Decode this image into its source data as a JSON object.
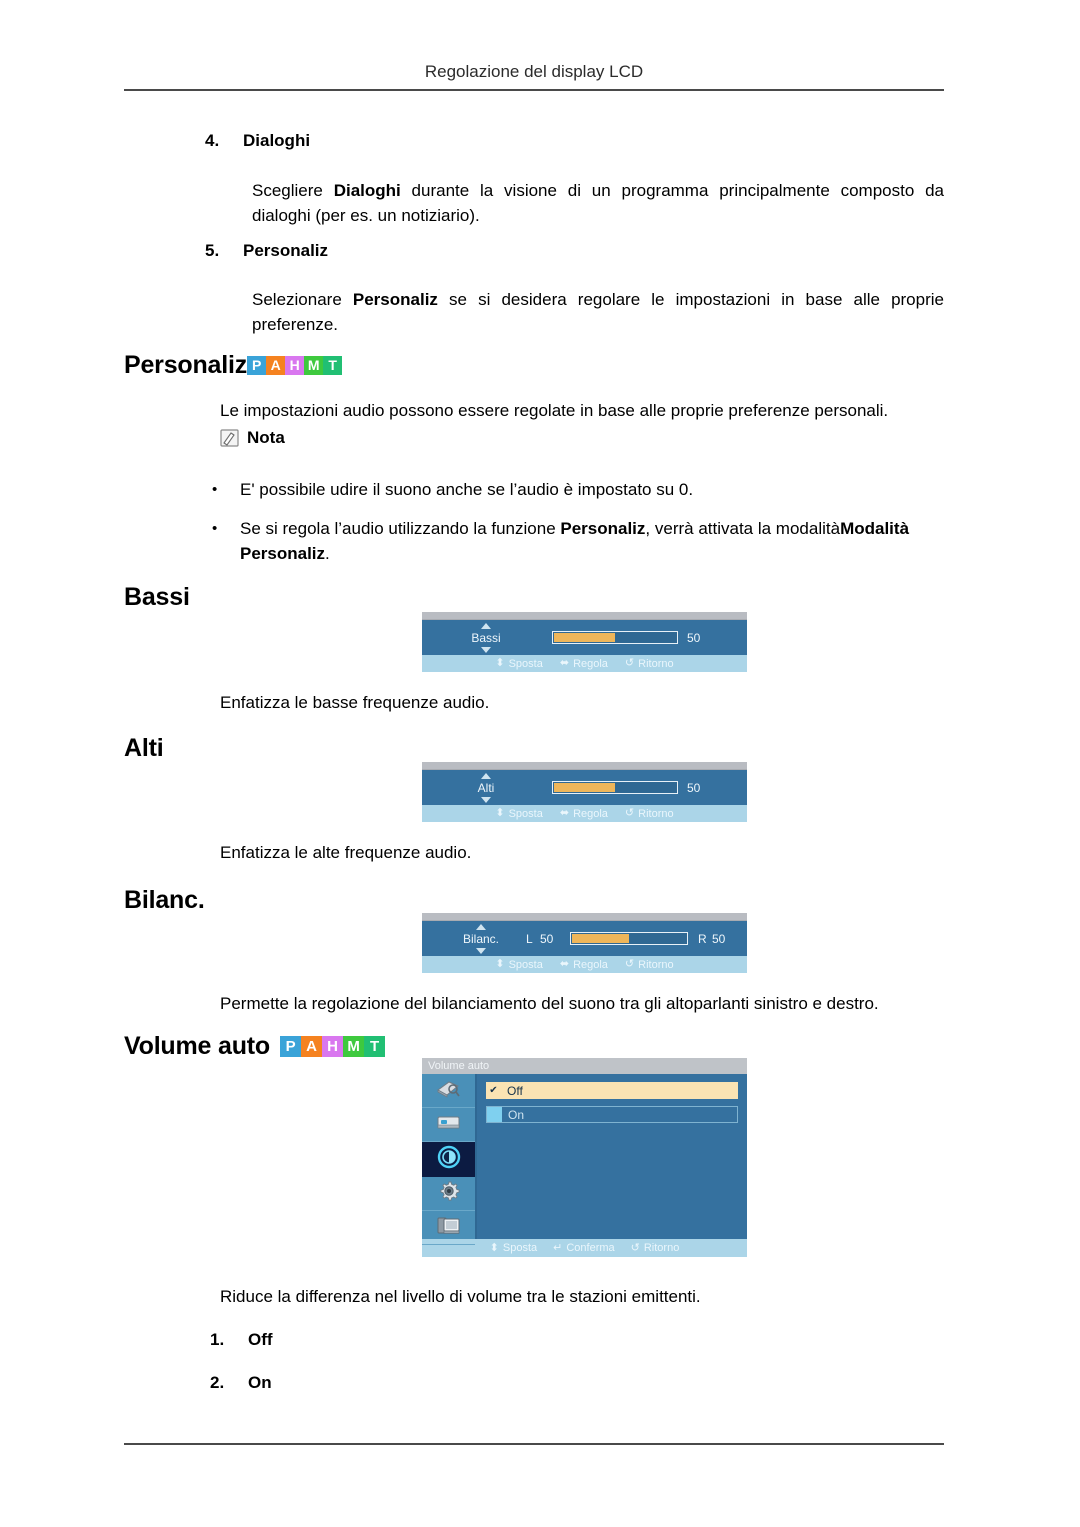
{
  "header": {
    "title": "Regolazione del display LCD"
  },
  "steps": [
    {
      "num": "4.",
      "label": "Dialoghi"
    },
    {
      "num": "5.",
      "label": "Personaliz"
    }
  ],
  "paragraphs": {
    "dialoghi_desc_a": "Scegliere ",
    "dialoghi_desc_bold": "Dialoghi",
    "dialoghi_desc_b": " durante la visione di un programma principalmente composto da dialoghi (per es. un notiziario).",
    "personaliz_desc_a": "Selezionare ",
    "personaliz_desc_bold": "Personaliz",
    "personaliz_desc_b": " se si desidera regolare le impostazioni in base alle proprie preferenze.",
    "personaliz_intro": "Le impostazioni audio possono essere regolate in base alle proprie preferenze personali.",
    "bassi_desc": "Enfatizza le basse frequenze audio.",
    "alti_desc": "Enfatizza le alte frequenze audio.",
    "bilanc_desc": "Permette la regolazione del bilanciamento del suono tra gli altoparlanti sinistro e destro.",
    "volume_auto_desc": "Riduce la differenza nel livello di volume tra le stazioni emittenti."
  },
  "note": {
    "icon": "note-pencil-icon",
    "label": "Nota",
    "bullets": [
      {
        "marker": "•",
        "text_a": "E' possibile udire il suono anche se l’audio è impostato su 0.",
        "bold_1": "",
        "text_b": "",
        "bold_2": "",
        "text_c": ""
      },
      {
        "marker": "•",
        "text_a": "Se si regola l’audio utilizzando la funzione ",
        "bold_1": "Personaliz",
        "text_b": ", verrà attivata la modalità",
        "bold_2": "Modalità Personaliz",
        "text_c": "."
      }
    ]
  },
  "badges": {
    "items": [
      {
        "letter": "P",
        "color": "#3aa3d8"
      },
      {
        "letter": "A",
        "color": "#f58220"
      },
      {
        "letter": "H",
        "color": "#d977ef"
      },
      {
        "letter": "M",
        "color": "#3ec93e"
      },
      {
        "letter": "T",
        "color": "#21bf73"
      }
    ]
  },
  "sections": {
    "personaliz_heading": "Personaliz",
    "bassi_heading": "Bassi",
    "alti_heading": "Alti",
    "bilanc_heading": "Bilanc.",
    "volume_auto_heading": "Volume auto"
  },
  "osd_bassi": {
    "label": "Bassi",
    "value": "50",
    "fill_percent": 50,
    "footer": [
      {
        "glyph": "⬍",
        "label": "Sposta"
      },
      {
        "glyph": "⬌",
        "label": "Regola"
      },
      {
        "glyph": "↺",
        "label": "Ritorno"
      }
    ]
  },
  "osd_alti": {
    "label": "Alti",
    "value": "50",
    "fill_percent": 50,
    "footer": [
      {
        "glyph": "⬍",
        "label": "Sposta"
      },
      {
        "glyph": "⬌",
        "label": "Regola"
      },
      {
        "glyph": "↺",
        "label": "Ritorno"
      }
    ]
  },
  "osd_bilanc": {
    "label": "Bilanc.",
    "left_label": "L",
    "left_value": "50",
    "right_label": "R",
    "right_value": "50",
    "fill_percent": 50,
    "footer": [
      {
        "glyph": "⬍",
        "label": "Sposta"
      },
      {
        "glyph": "⬌",
        "label": "Regola"
      },
      {
        "glyph": "↺",
        "label": "Ritorno"
      }
    ]
  },
  "osd_volume_auto": {
    "title": "Volume auto",
    "rail_icons": [
      "picture-icon",
      "input-source-icon",
      "sound-icon",
      "setup-gear-icon",
      "multi-control-icon"
    ],
    "active_rail_index": 2,
    "options": [
      {
        "label": "Off",
        "selected": true,
        "mark": "✔"
      },
      {
        "label": "On",
        "selected": false,
        "mark": ""
      }
    ],
    "footer": [
      {
        "glyph": "⬍",
        "label": "Sposta"
      },
      {
        "glyph": "↵",
        "label": "Conferma"
      },
      {
        "glyph": "↺",
        "label": "Ritorno"
      }
    ]
  },
  "numbered_options": [
    {
      "num": "1.",
      "label": "Off"
    },
    {
      "num": "2.",
      "label": "On"
    }
  ]
}
